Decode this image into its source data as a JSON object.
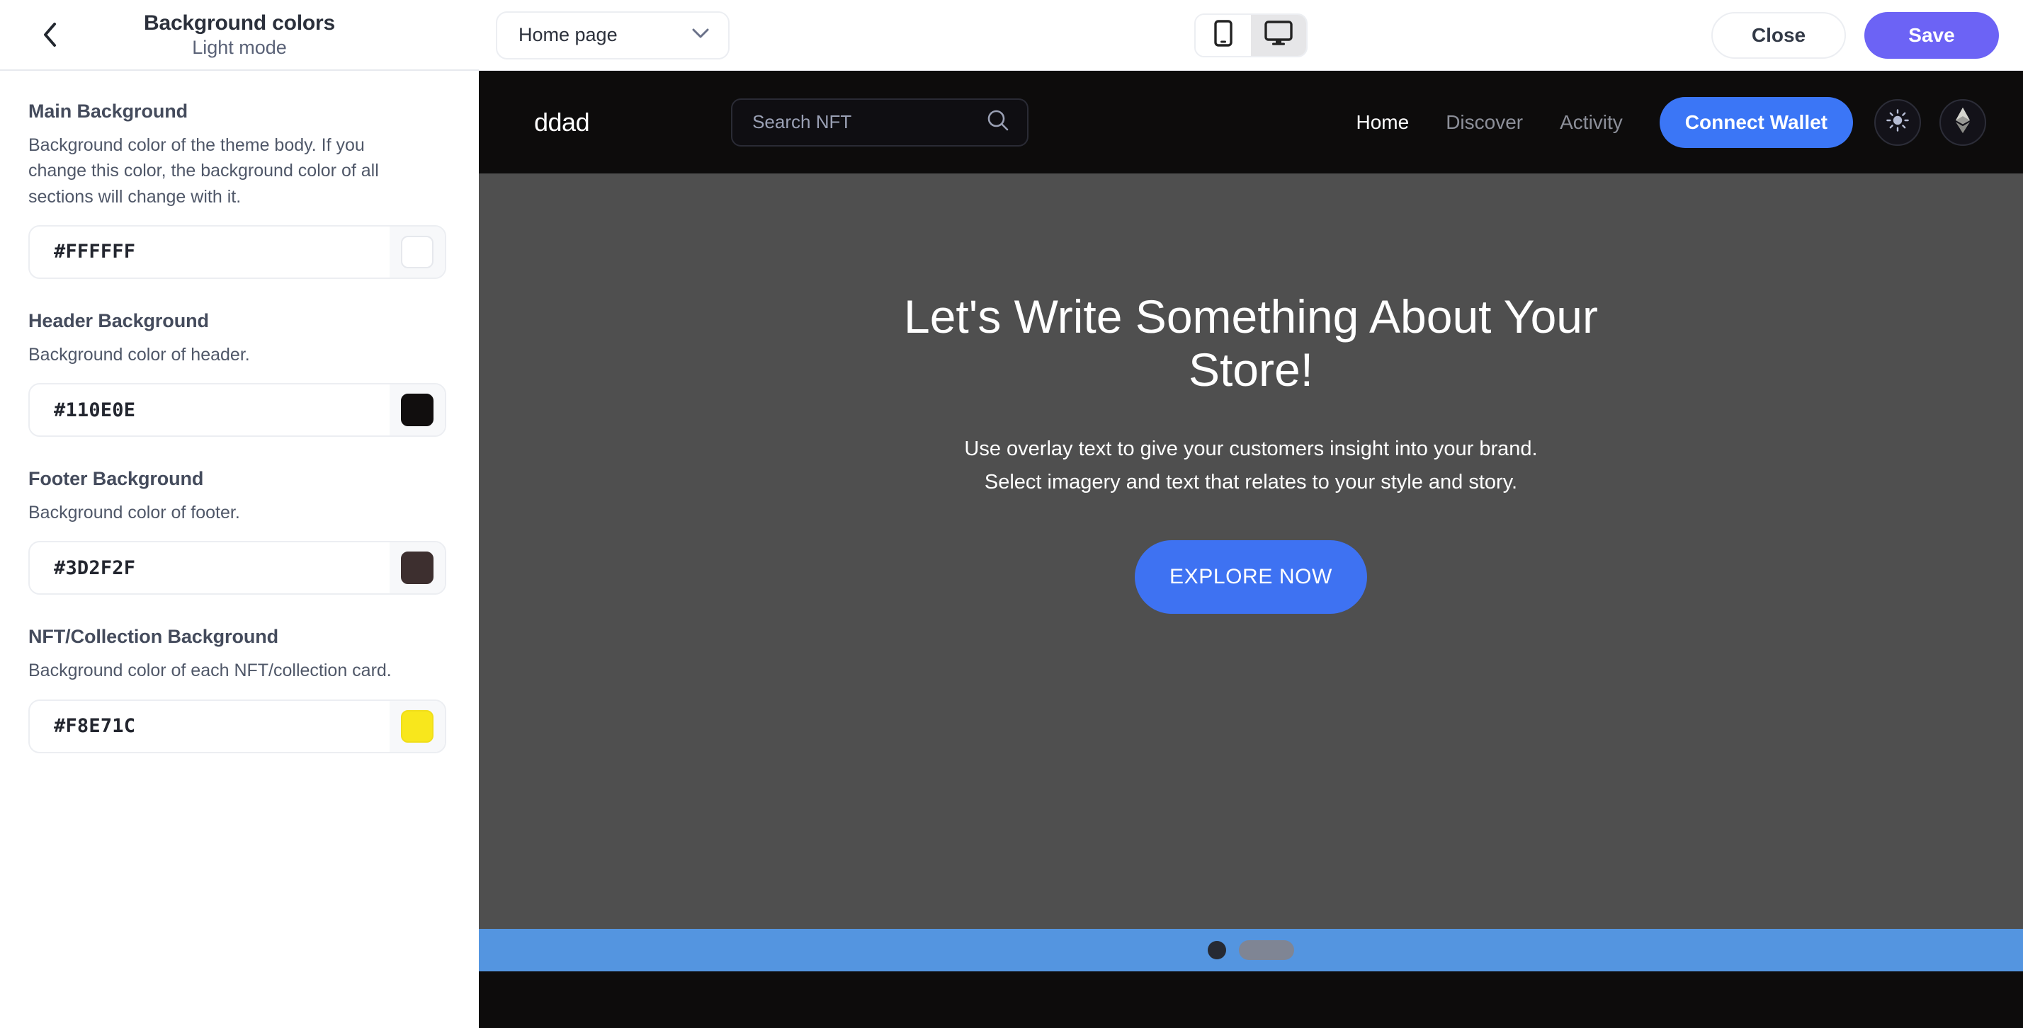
{
  "sidebar": {
    "back_icon": "chevron-left-icon",
    "title": "Background colors",
    "subtitle": "Light mode",
    "fields": [
      {
        "label": "Main Background",
        "description": "Background color of the theme body. If you change this color, the background color of all sections will change with it.",
        "value": "#FFFFFF",
        "swatch": "#FFFFFF"
      },
      {
        "label": "Header Background",
        "description": "Background color of header.",
        "value": "#110E0E",
        "swatch": "#110E0E"
      },
      {
        "label": "Footer Background",
        "description": "Background color of footer.",
        "value": "#3D2F2F",
        "swatch": "#3D2F2F"
      },
      {
        "label": "NFT/Collection Background",
        "description": "Background color of each NFT/collection card.",
        "value": "#F8E71C",
        "swatch": "#F8E71C"
      }
    ]
  },
  "topbar": {
    "page_select": {
      "value": "Home page",
      "icon": "chevron-down-icon"
    },
    "device_toggle": {
      "mobile": {
        "icon": "mobile-icon",
        "active": false
      },
      "desktop": {
        "icon": "desktop-icon",
        "active": true
      }
    },
    "close_label": "Close",
    "save_label": "Save",
    "save_color": "#6C63F5"
  },
  "preview": {
    "header": {
      "logo": "ddad",
      "background": "#110E0E",
      "search_placeholder": "Search NFT",
      "search_icon": "search-icon",
      "nav": [
        {
          "label": "Home",
          "active": true
        },
        {
          "label": "Discover",
          "active": false
        },
        {
          "label": "Activity",
          "active": false
        }
      ],
      "wallet_button": {
        "label": "Connect Wallet",
        "color": "#3B76F6"
      },
      "light_mode_icon": "sun-icon",
      "currency_icon": "ethereum-icon"
    },
    "hero": {
      "background": "#4F4F4F",
      "title": "Let's Write Something About Your Store!",
      "subtitle_line1": "Use overlay text to give your customers insight into your brand.",
      "subtitle_line2": "Select imagery and text that relates to your style and story.",
      "cta_label": "EXPLORE NOW",
      "cta_color": "#3E72F2"
    },
    "carousel": {
      "band_color": "#5495E0",
      "dot_icon": "carousel-dot",
      "active_indicator": "carousel-active-bar"
    },
    "footer": {
      "background": "#3D2F2F"
    }
  }
}
